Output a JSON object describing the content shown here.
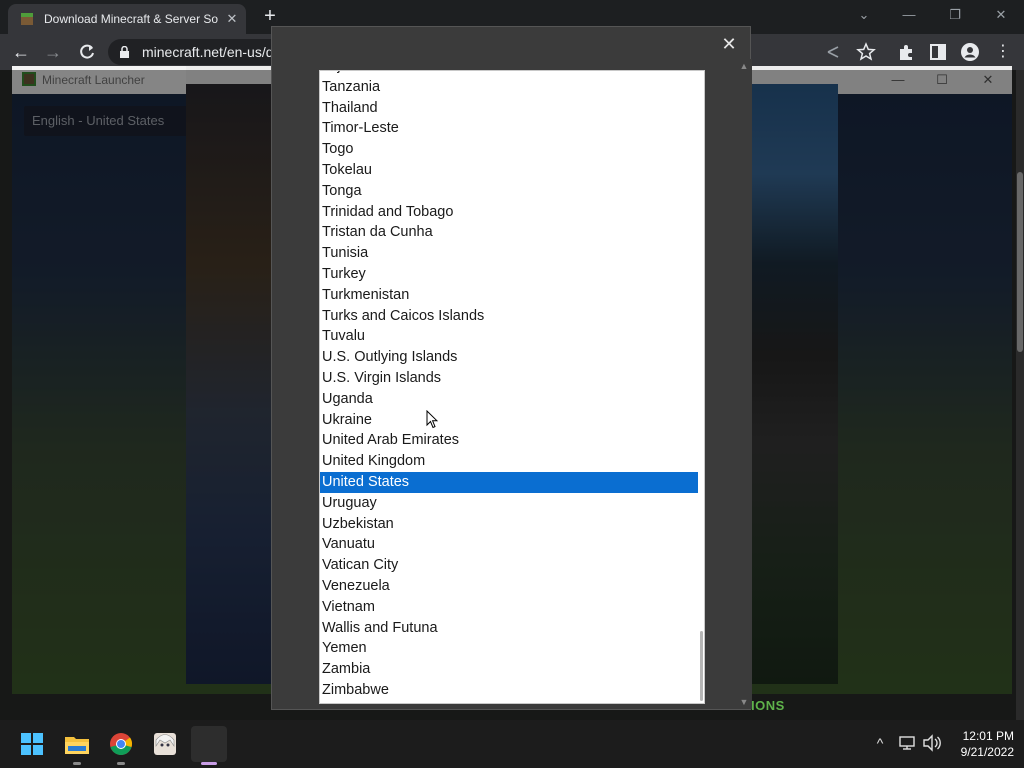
{
  "browser": {
    "tab_title": "Download Minecraft & Server So",
    "tab_close_icon": "close-icon",
    "new_tab_icon": "plus-icon",
    "url": "minecraft.net/en-us/d",
    "window_controls": {
      "chevron": "⌄",
      "minimize": "—",
      "restore": "❐",
      "close": "✕"
    }
  },
  "launcher": {
    "title": "Minecraft Launcher",
    "language": "English - United States",
    "controls": {
      "minimize": "—",
      "maximize": "☐",
      "close": "✕"
    }
  },
  "modal": {
    "close_icon": "close-icon",
    "close_label": "✕"
  },
  "country_list": {
    "items": [
      "Tajikistan",
      "Tanzania",
      "Thailand",
      "Timor-Leste",
      "Togo",
      "Tokelau",
      "Tonga",
      "Trinidad and Tobago",
      "Tristan da Cunha",
      "Tunisia",
      "Turkey",
      "Turkmenistan",
      "Turks and Caicos Islands",
      "Tuvalu",
      "U.S. Outlying Islands",
      "U.S. Virgin Islands",
      "Uganda",
      "Ukraine",
      "United Arab Emirates",
      "United Kingdom",
      "United States",
      "Uruguay",
      "Uzbekistan",
      "Vanuatu",
      "Vatican City",
      "Venezuela",
      "Vietnam",
      "Wallis and Futuna",
      "Yemen",
      "Zambia",
      "Zimbabwe"
    ],
    "selected": "United States"
  },
  "page": {
    "banner_text": "— FIND ARCH AND RPM BASED DISTRIBUTIONS"
  },
  "taskbar": {
    "apps": [
      "windows-start",
      "file-explorer",
      "chrome",
      "anime-avatar-app",
      "terminal-app"
    ],
    "time": "12:01 PM",
    "date": "9/21/2022"
  },
  "colors": {
    "selection": "#0a6ed1",
    "chrome_toolbar": "#35363a",
    "taskbar": "#1c1c1c"
  }
}
